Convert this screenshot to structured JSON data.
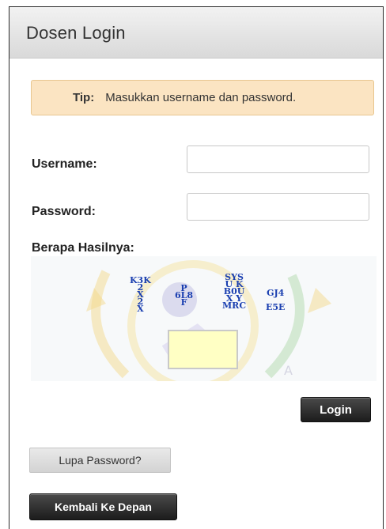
{
  "header": {
    "title": "Dosen Login"
  },
  "tip": {
    "label": "Tip:",
    "text": "Masukkan username dan password."
  },
  "form": {
    "username_label": "Username:",
    "username_value": "",
    "password_label": "Password:",
    "password_value": "",
    "captcha_label": "Berapa Hasilnya:",
    "captcha_answer": ""
  },
  "captcha": {
    "groups": [
      "K3K\n2\nX\n2\nX",
      "P\n6L8\nF",
      "SYS\nU K\nB0U\nX Y\nMRC",
      "GJ4\nE5E"
    ]
  },
  "buttons": {
    "login": "Login",
    "forgot_password": "Lupa Password?",
    "back_home": "Kembali Ke Depan"
  },
  "colors": {
    "tip_bg": "#fbe4c2",
    "captcha_text": "#1a3fb0",
    "button_dark": "#2b2b2b"
  }
}
